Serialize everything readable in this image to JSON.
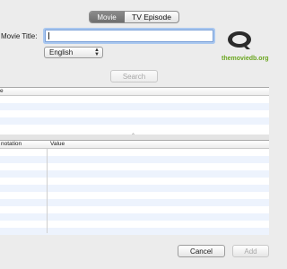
{
  "tabs": {
    "movie": "Movie",
    "tv_episode": "TV Episode"
  },
  "form": {
    "movie_title_label": "Movie Title:",
    "movie_title_value": "",
    "language_value": "English"
  },
  "logo": {
    "text": "themoviedb.org"
  },
  "search": {
    "label": "Search"
  },
  "results": {
    "header_fragment": "e"
  },
  "metadata": {
    "col1_header": "notation",
    "col2_header": "Value"
  },
  "buttons": {
    "cancel": "Cancel",
    "add": "Add"
  },
  "colors": {
    "logo_green": "#6aa61f",
    "focus_ring": "#a9c7ef",
    "row_alt": "#edf3fd"
  }
}
